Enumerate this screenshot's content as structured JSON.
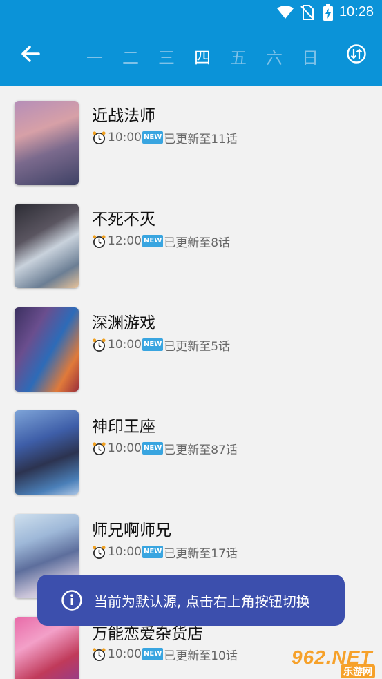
{
  "status_bar": {
    "time": "10:28"
  },
  "day_tabs": [
    "一",
    "二",
    "三",
    "四",
    "五",
    "六",
    "日"
  ],
  "active_day": "四",
  "colors": {
    "primary": "#0b93d8",
    "toast": "#3c4fad",
    "new_badge": "#39a5e0"
  },
  "items": [
    {
      "title": "近战法师",
      "time": "10:00",
      "badge": "NEW",
      "update": "已更新至11话"
    },
    {
      "title": "不死不灭",
      "time": "12:00",
      "badge": "NEW",
      "update": "已更新至8话"
    },
    {
      "title": "深渊游戏",
      "time": "10:00",
      "badge": "NEW",
      "update": "已更新至5话"
    },
    {
      "title": "神印王座",
      "time": "10:00",
      "badge": "NEW",
      "update": "已更新至87话"
    },
    {
      "title": "师兄啊师兄",
      "time": "10:00",
      "badge": "NEW",
      "update": "已更新至17话"
    },
    {
      "title": "万能恋爱杂货店",
      "time": "10:00",
      "badge": "NEW",
      "update": "已更新至10话"
    }
  ],
  "toast": {
    "message": "当前为默认源, 点击右上角按钮切换"
  },
  "watermark": {
    "main": "962.NET",
    "sub": "乐游网"
  }
}
